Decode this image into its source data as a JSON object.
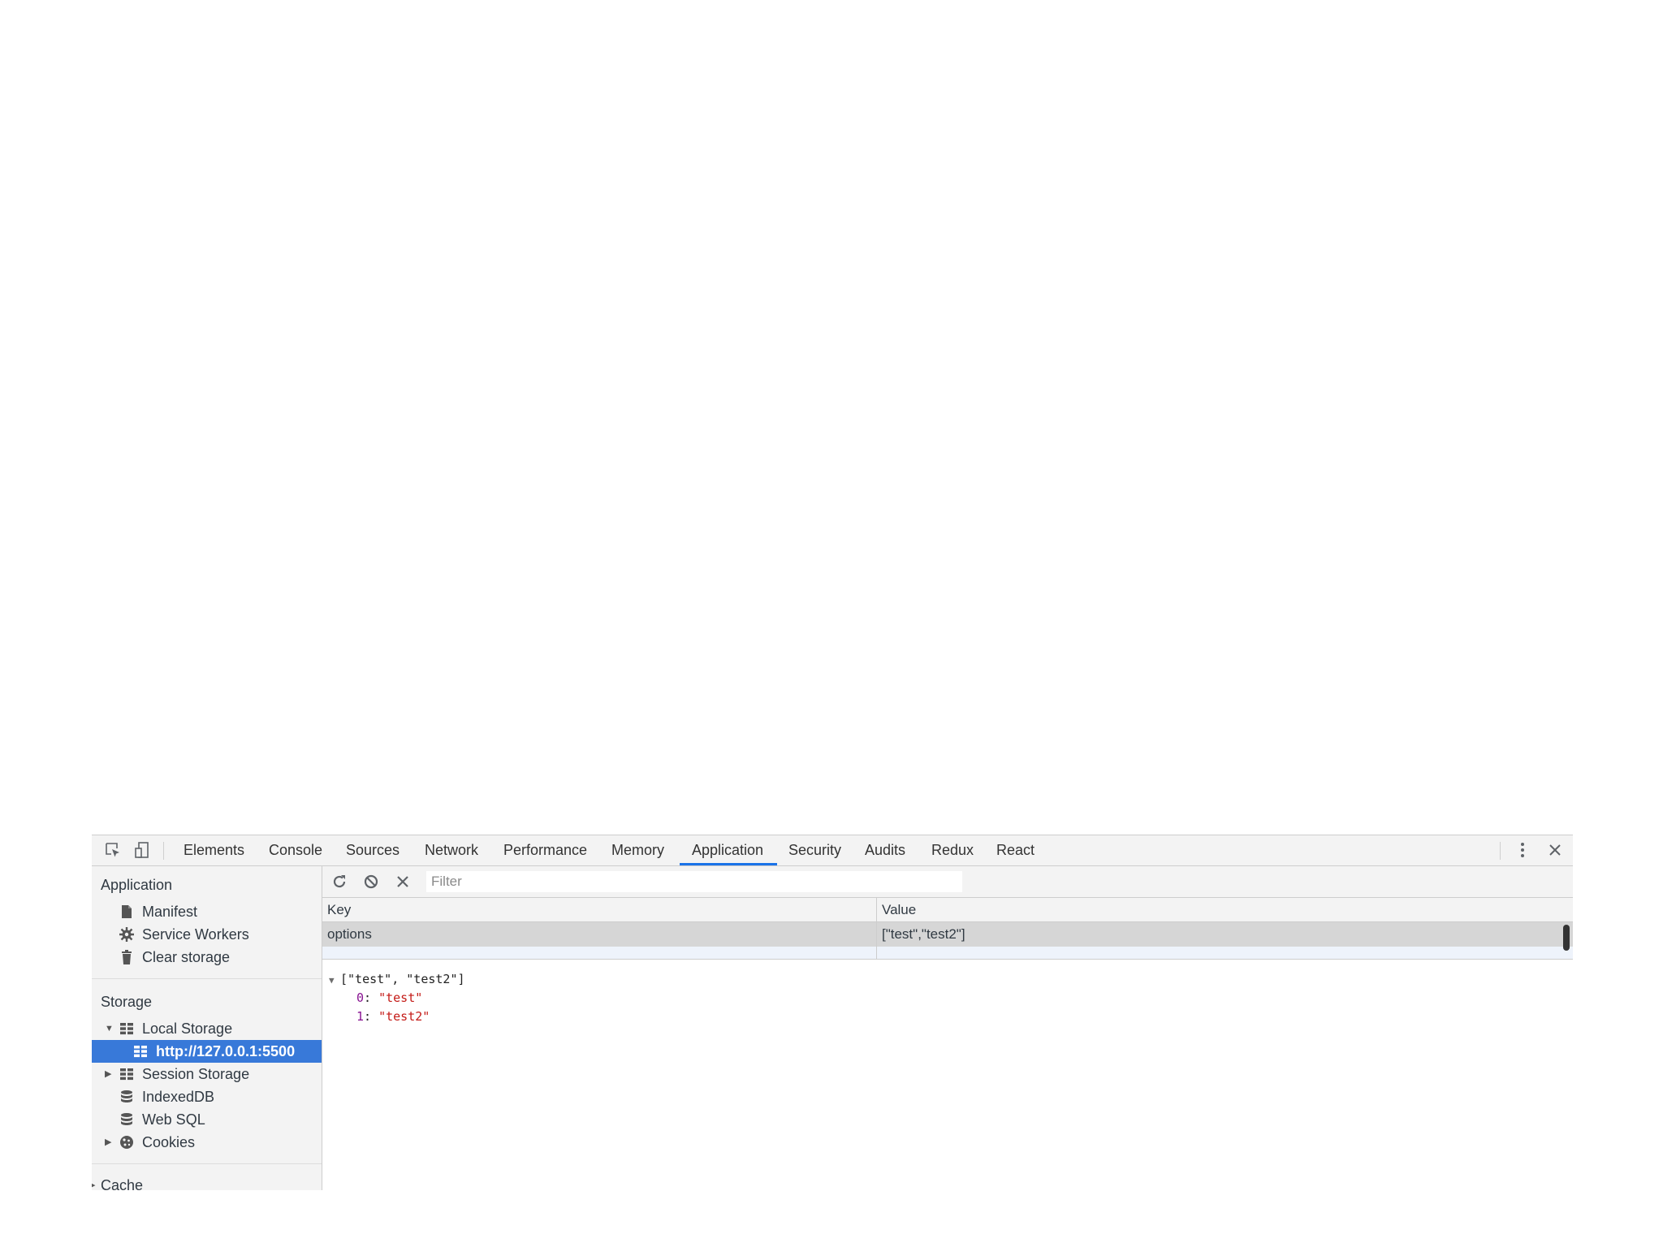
{
  "tabbar": {
    "icons": [
      "inspect-icon",
      "device-toolbar-icon"
    ],
    "tabs": [
      "Elements",
      "Console",
      "Sources",
      "Network",
      "Performance",
      "Memory",
      "Application",
      "Security",
      "Audits",
      "Redux",
      "React"
    ],
    "active_tab": "Application"
  },
  "sidebar": {
    "application_header": "Application",
    "application_items": [
      {
        "label": "Manifest",
        "icon": "file-icon"
      },
      {
        "label": "Service Workers",
        "icon": "gear-icon"
      },
      {
        "label": "Clear storage",
        "icon": "trash-icon"
      }
    ],
    "storage_header": "Storage",
    "storage_items": [
      {
        "label": "Local Storage",
        "icon": "grid-icon",
        "expanded": true
      },
      {
        "label": "http://127.0.0.1:5500",
        "icon": "grid-icon",
        "selected": true
      },
      {
        "label": "Session Storage",
        "icon": "grid-icon",
        "expanded": false
      },
      {
        "label": "IndexedDB",
        "icon": "database-icon"
      },
      {
        "label": "Web SQL",
        "icon": "database-icon"
      },
      {
        "label": "Cookies",
        "icon": "cookie-icon",
        "expanded": false
      }
    ],
    "cache_header": "Cache"
  },
  "toolbar": {
    "filter_placeholder": "Filter"
  },
  "grid": {
    "columns": [
      "Key",
      "Value"
    ],
    "rows": [
      {
        "key": "options",
        "value": "[\"test\",\"test2\"]"
      }
    ]
  },
  "preview": {
    "summary": "[\"test\", \"test2\"]",
    "entries": [
      {
        "index": "0",
        "value": "\"test\""
      },
      {
        "index": "1",
        "value": "\"test2\""
      }
    ]
  },
  "colors": {
    "accent": "#1a73e8",
    "selection": "#3879d9",
    "string": "#c41a16",
    "index": "#881391"
  }
}
